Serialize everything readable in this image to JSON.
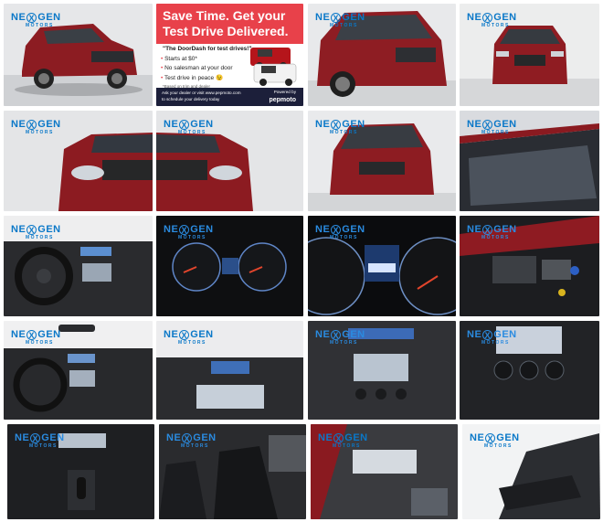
{
  "gallery": {
    "dealer_logo": {
      "name": "NEXGEN",
      "sub": "MOTORS"
    },
    "promo": {
      "headline_1": "Save Time. Get your",
      "headline_2": "Test Drive Delivered.",
      "quote": "\"The DoorDash for test drives!\"",
      "bullets": [
        "Starts at $0*",
        "No salesman at your door",
        "Test drive in peace 😉"
      ],
      "fine_print": "*Based on trim and dealer",
      "footer_line_1": "Ask your dealer or visit www.pepmoto.com",
      "footer_line_2": "to schedule your delivery today",
      "powered_by": "Powered by",
      "brand": "pepmoto"
    },
    "photos": [
      {
        "alt": "Red SUV front three-quarter exterior view"
      },
      {
        "alt": "Test drive delivery promotion"
      },
      {
        "alt": "Red SUV front three-quarter close view"
      },
      {
        "alt": "Red SUV front view"
      },
      {
        "alt": "Front grille and headlight detail left"
      },
      {
        "alt": "Front grille and headlight detail right"
      },
      {
        "alt": "Red SUV front low angle view"
      },
      {
        "alt": "Windshield and mirror detail"
      },
      {
        "alt": "Interior dashboard and steering wheel"
      },
      {
        "alt": "Instrument cluster gauges"
      },
      {
        "alt": "Instrument cluster close-up"
      },
      {
        "alt": "Engine bay"
      },
      {
        "alt": "Interior dashboard wide view"
      },
      {
        "alt": "Center console infotainment screen"
      },
      {
        "alt": "Center stack and radio controls"
      },
      {
        "alt": "Climate control knobs"
      },
      {
        "alt": "Center console and gear shifter"
      },
      {
        "alt": "Front seats and door panel"
      },
      {
        "alt": "Sunroof interior view"
      },
      {
        "alt": "Rear view mirror detail"
      }
    ]
  }
}
